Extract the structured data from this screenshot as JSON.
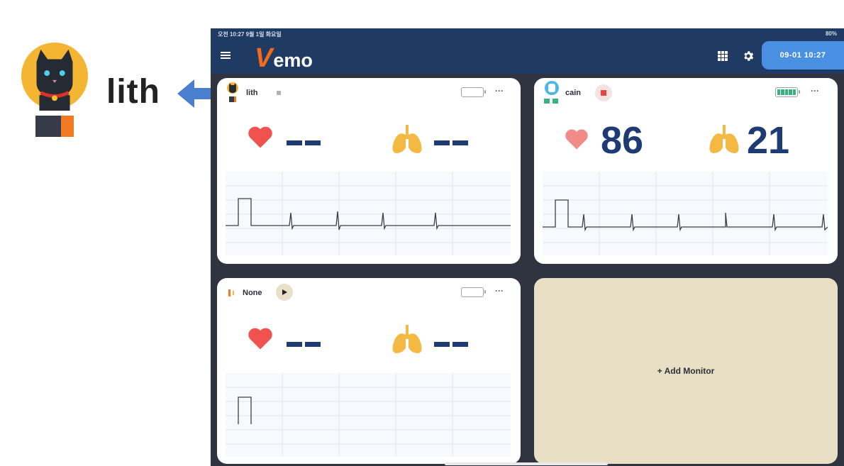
{
  "callout": {
    "name": "lith"
  },
  "status_bar": {
    "time_date": "오전 10:27  9월 1일 화요일",
    "battery": "80%"
  },
  "app": {
    "logo_initial": "V",
    "logo_rest": "emo",
    "datetime": "09-01 10:27"
  },
  "monitors": [
    {
      "name": "lith",
      "heart_rate": "--",
      "resp_rate": "--"
    },
    {
      "name": "cain",
      "heart_rate": "86",
      "resp_rate": "21"
    },
    {
      "name": "None",
      "heart_rate": "--",
      "resp_rate": "--"
    }
  ],
  "add_monitor": {
    "label": "+ Add Monitor"
  },
  "colors": {
    "navy": "#1f3b63",
    "orange": "#f26a1b",
    "blue": "#4a90e2",
    "heart": "#f0524f",
    "lungs": "#f4b942",
    "value": "#1f3b73"
  }
}
